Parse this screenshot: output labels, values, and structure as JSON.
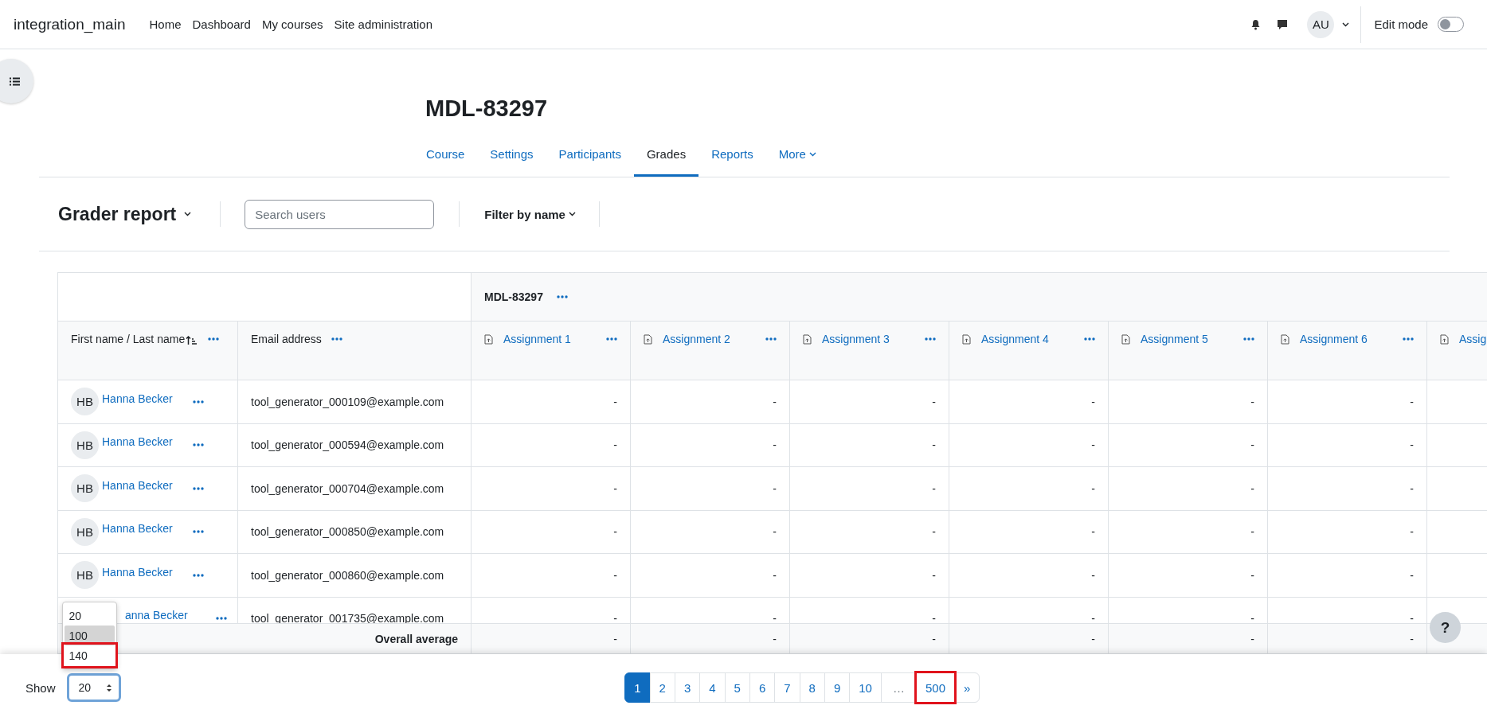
{
  "site_name": "integration_main",
  "nav": [
    "Home",
    "Dashboard",
    "My courses",
    "Site administration"
  ],
  "user": {
    "initials": "AU"
  },
  "edit_mode": {
    "label": "Edit mode",
    "on": false
  },
  "course": {
    "title": "MDL-83297"
  },
  "tabs": [
    {
      "label": "Course",
      "selected": false,
      "kind": "link"
    },
    {
      "label": "Settings",
      "selected": false,
      "kind": "link"
    },
    {
      "label": "Participants",
      "selected": false,
      "kind": "link"
    },
    {
      "label": "Grades",
      "selected": true,
      "kind": "link"
    },
    {
      "label": "Reports",
      "selected": false,
      "kind": "link"
    },
    {
      "label": "More",
      "selected": false,
      "kind": "menu"
    }
  ],
  "report": {
    "title": "Grader report",
    "search": {
      "placeholder": "Search users"
    },
    "filter": "Filter by name"
  },
  "table": {
    "category": "MDL-83297",
    "columns": [
      {
        "label": "First name / Last name",
        "kind": "name"
      },
      {
        "label": "Email address",
        "kind": "text"
      },
      {
        "label": "Assignment 1",
        "kind": "assignment"
      },
      {
        "label": "Assignment 2",
        "kind": "assignment"
      },
      {
        "label": "Assignment 3",
        "kind": "assignment"
      },
      {
        "label": "Assignment 4",
        "kind": "assignment"
      },
      {
        "label": "Assignment 5",
        "kind": "assignment"
      },
      {
        "label": "Assignment 6",
        "kind": "assignment"
      },
      {
        "label": "Assig",
        "kind": "assignment"
      }
    ],
    "rows": [
      {
        "initials": "HB",
        "name": "Hanna Becker",
        "email": "tool_generator_000109@example.com",
        "grades": [
          "-",
          "-",
          "-",
          "-",
          "-",
          "-"
        ]
      },
      {
        "initials": "HB",
        "name": "Hanna Becker",
        "email": "tool_generator_000594@example.com",
        "grades": [
          "-",
          "-",
          "-",
          "-",
          "-",
          "-"
        ]
      },
      {
        "initials": "HB",
        "name": "Hanna Becker",
        "email": "tool_generator_000704@example.com",
        "grades": [
          "-",
          "-",
          "-",
          "-",
          "-",
          "-"
        ]
      },
      {
        "initials": "HB",
        "name": "Hanna Becker",
        "email": "tool_generator_000850@example.com",
        "grades": [
          "-",
          "-",
          "-",
          "-",
          "-",
          "-"
        ]
      },
      {
        "initials": "HB",
        "name": "Hanna Becker",
        "email": "tool_generator_000860@example.com",
        "grades": [
          "-",
          "-",
          "-",
          "-",
          "-",
          "-"
        ]
      },
      {
        "name": "anna Becker",
        "email": "tool_generator_001735@example.com",
        "grades": [
          "-",
          "-",
          "-",
          "-",
          "-",
          "-"
        ]
      }
    ],
    "average": {
      "label": "Overall average",
      "grades": [
        "-",
        "-",
        "-",
        "-",
        "-",
        "-"
      ]
    }
  },
  "page_size": {
    "label": "Show",
    "value": "20",
    "options": [
      {
        "label": "20",
        "hovered": false,
        "marked": false
      },
      {
        "label": "100",
        "hovered": true,
        "marked": false
      },
      {
        "label": "140",
        "hovered": false,
        "marked": true
      }
    ]
  },
  "pagination": {
    "pages": [
      {
        "label": "1",
        "selected": true,
        "kind": "page",
        "marked": false
      },
      {
        "label": "2",
        "selected": false,
        "kind": "page",
        "marked": false
      },
      {
        "label": "3",
        "selected": false,
        "kind": "page",
        "marked": false
      },
      {
        "label": "4",
        "selected": false,
        "kind": "page",
        "marked": false
      },
      {
        "label": "5",
        "selected": false,
        "kind": "page",
        "marked": false
      },
      {
        "label": "6",
        "selected": false,
        "kind": "page",
        "marked": false
      },
      {
        "label": "7",
        "selected": false,
        "kind": "page",
        "marked": false
      },
      {
        "label": "8",
        "selected": false,
        "kind": "page",
        "marked": false
      },
      {
        "label": "9",
        "selected": false,
        "kind": "page",
        "marked": false
      },
      {
        "label": "10",
        "selected": false,
        "kind": "page",
        "marked": false
      },
      {
        "label": "…",
        "selected": false,
        "kind": "ellipsis",
        "marked": false
      },
      {
        "label": "500",
        "selected": false,
        "kind": "page",
        "marked": true
      },
      {
        "label": "»",
        "selected": false,
        "kind": "next",
        "marked": false
      }
    ]
  },
  "help": "?"
}
